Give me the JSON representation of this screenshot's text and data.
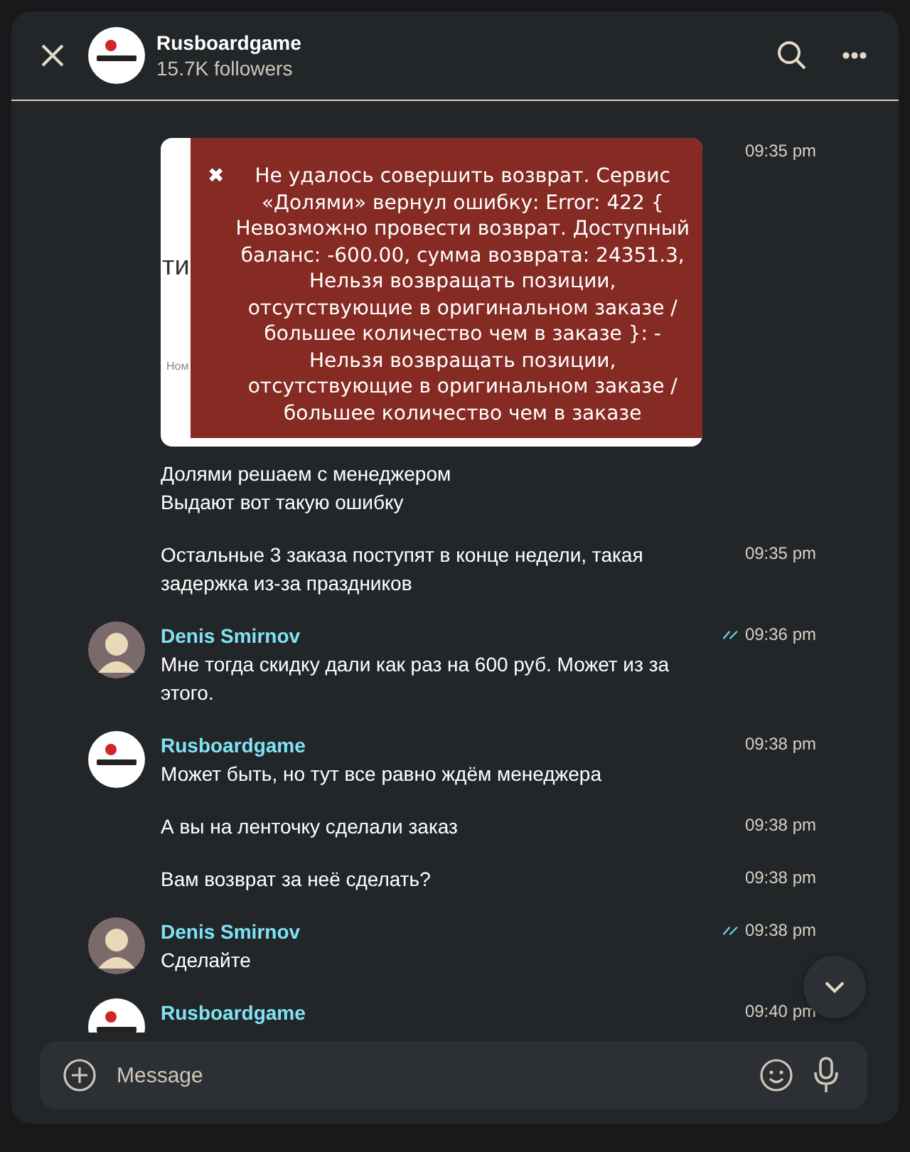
{
  "header": {
    "title": "Rusboardgame",
    "subtitle": "15.7K followers"
  },
  "messages": [
    {
      "kind": "image",
      "time": "09:35 pm",
      "read": false,
      "screenshot": {
        "heading": "ти",
        "hint": "Ном",
        "error": "Не удалось совершить возврат. Сервис «Долями» вернул ошибку: Error: 422 { Невозможно провести возврат. Доступный баланс: -600.00, сумма возврата: 24351.3, Нельзя возвращать позиции, отсутствующие в оригинальном заказе / большее количество чем в заказе }: - Нельзя возвращать позиции, отсутствующие в оригинальном заказе / большее количество чем в заказе",
        "error_icon": "✖"
      }
    },
    {
      "kind": "text",
      "text": "Долями решаем с менеджером\nВыдают вот такую ошибку"
    },
    {
      "kind": "text",
      "text": "Остальные 3 заказа поступят в конце недели, такая задержка из-за праздников",
      "time": "09:35 pm",
      "read": false
    },
    {
      "kind": "text",
      "author": "Denis Smirnov",
      "avatar": {
        "kind": "person"
      },
      "text": "Мне тогда скидку дали как раз на 600 руб. Может из за этого.",
      "time": "09:36 pm",
      "read": true
    },
    {
      "kind": "text",
      "author": "Rusboardgame",
      "avatar": {
        "kind": "logo"
      },
      "text": "Может быть, но тут все равно ждём менеджера",
      "time": "09:38 pm",
      "read": false
    },
    {
      "kind": "text",
      "text": "А вы на ленточку сделали заказ",
      "time": "09:38 pm",
      "read": false
    },
    {
      "kind": "text",
      "text": "Вам возврат за неё сделать?",
      "time": "09:38 pm",
      "read": false
    },
    {
      "kind": "text",
      "author": "Denis Smirnov",
      "avatar": {
        "kind": "person"
      },
      "text": "Сделайте",
      "time": "09:38 pm",
      "read": true
    },
    {
      "kind": "text",
      "author": "Rusboardgame",
      "avatar": {
        "kind": "logo"
      },
      "time": "09:40 pm",
      "read": false
    }
  ],
  "composer": {
    "placeholder": "Message"
  }
}
